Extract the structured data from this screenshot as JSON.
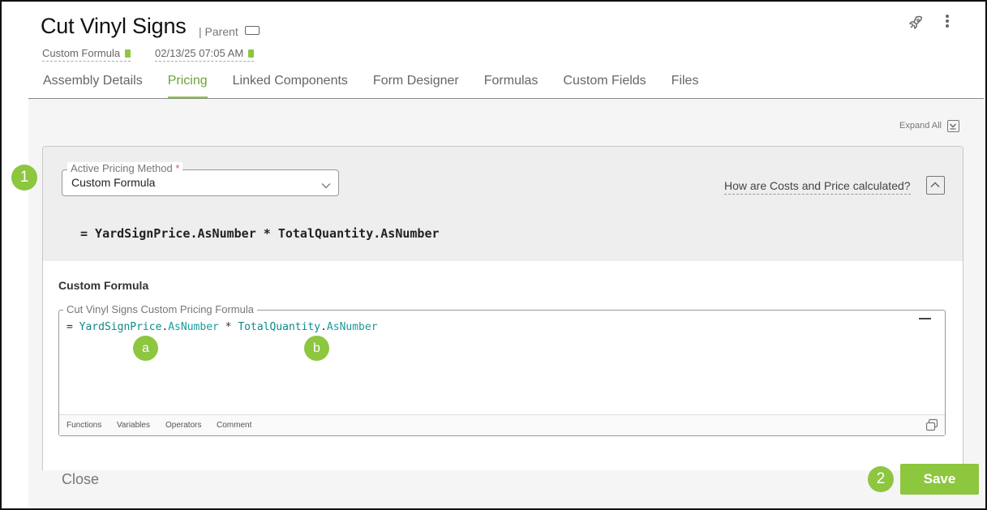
{
  "header": {
    "title": "Cut Vinyl Signs",
    "parent_label": "| Parent",
    "pricing_method_meta": "Custom Formula",
    "timestamp": "02/13/25 07:05 AM"
  },
  "icons": {
    "rocket": "rocket-icon",
    "more": "kebab-menu-icon",
    "parent": "rectangle-icon",
    "calendar": "calendar-check-icon",
    "document": "document-icon"
  },
  "tabs": [
    {
      "label": "Assembly Details",
      "active": false
    },
    {
      "label": "Pricing",
      "active": true
    },
    {
      "label": "Linked Components",
      "active": false
    },
    {
      "label": "Form Designer",
      "active": false
    },
    {
      "label": "Formulas",
      "active": false
    },
    {
      "label": "Custom Fields",
      "active": false
    },
    {
      "label": "Files",
      "active": false
    }
  ],
  "pricing": {
    "expand_all": "Expand All",
    "active_method_label": "Active Pricing Method",
    "required_marker": "*",
    "active_method_value": "Custom Formula",
    "how_link": "How are Costs and Price calculated?",
    "formula_summary": "= YardSignPrice.AsNumber * TotalQuantity.AsNumber",
    "section_title": "Custom Formula",
    "editor_label": "Cut Vinyl Signs Custom Pricing Formula",
    "editor_code": {
      "eq": "= ",
      "var1": "YardSignPrice",
      "dot1": ".",
      "prop1": "AsNumber",
      "op": " * ",
      "var2": "TotalQuantity",
      "dot2": ".",
      "prop2": "AsNumber"
    },
    "editor_footer": [
      "Functions",
      "Variables",
      "Operators",
      "Comment"
    ]
  },
  "callouts": {
    "one": "1",
    "two": "2",
    "a": "a",
    "b": "b"
  },
  "footer": {
    "close_label": "Close",
    "save_label": "Save"
  },
  "colors": {
    "accent": "#8dc63f",
    "code_variable": "#0f8a8a"
  }
}
